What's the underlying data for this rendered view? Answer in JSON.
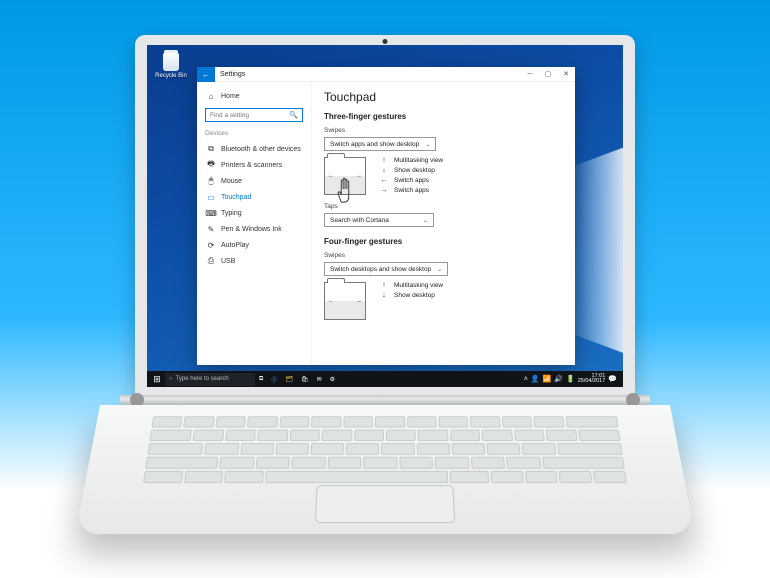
{
  "desktop": {
    "recycle_label": "Recycle Bin"
  },
  "window": {
    "app_title": "Settings",
    "back_glyph": "←"
  },
  "sidebar": {
    "home": "Home",
    "search_placeholder": "Find a setting",
    "section": "Devices",
    "items": [
      {
        "label": "Bluetooth & other devices",
        "icon": "⧉"
      },
      {
        "label": "Printers & scanners",
        "icon": "🖶"
      },
      {
        "label": "Mouse",
        "icon": "🖱"
      },
      {
        "label": "Touchpad",
        "icon": "▭"
      },
      {
        "label": "Typing",
        "icon": "⌨"
      },
      {
        "label": "Pen & Windows Ink",
        "icon": "✎"
      },
      {
        "label": "AutoPlay",
        "icon": "⟳"
      },
      {
        "label": "USB",
        "icon": "⎙"
      }
    ]
  },
  "content": {
    "page_title": "Touchpad",
    "three": {
      "heading": "Three-finger gestures",
      "swipes_label": "Swipes",
      "swipes_value": "Switch apps and show desktop",
      "gestures": [
        {
          "arrow": "↑",
          "label": "Multitasking view"
        },
        {
          "arrow": "↓",
          "label": "Show desktop"
        },
        {
          "arrow": "←",
          "label": "Switch apps"
        },
        {
          "arrow": "→",
          "label": "Switch apps"
        }
      ],
      "taps_label": "Taps",
      "taps_value": "Search with Cortana"
    },
    "four": {
      "heading": "Four-finger gestures",
      "swipes_label": "Swipes",
      "swipes_value": "Switch desktops and show desktop",
      "gestures": [
        {
          "arrow": "↑",
          "label": "Multitasking view"
        },
        {
          "arrow": "↓",
          "label": "Show desktop"
        }
      ]
    }
  },
  "taskbar": {
    "search_placeholder": "Type here to search",
    "time": "17:01",
    "date": "25/04/2017"
  }
}
